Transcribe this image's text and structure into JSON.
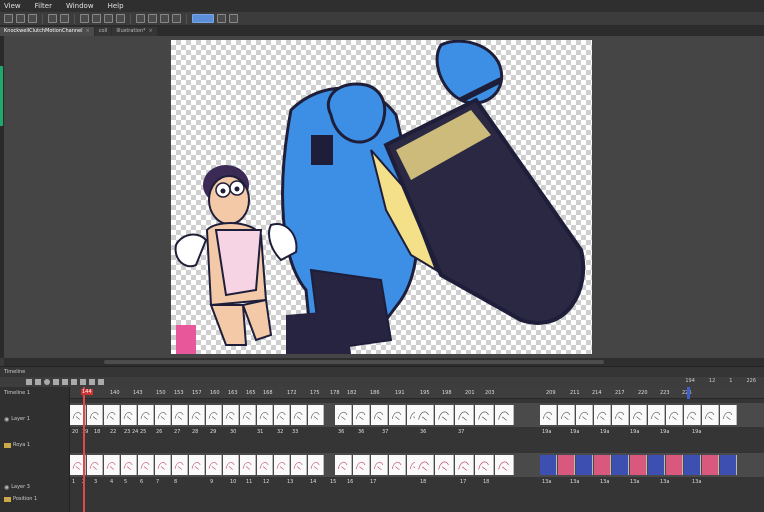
{
  "menu": [
    "View",
    "Filter",
    "Window",
    "Help"
  ],
  "tabs": [
    {
      "label": "KnockwellClutchMotionChannel",
      "active": true
    },
    {
      "label": "coll",
      "active": false
    },
    {
      "label": "Illustration*",
      "active": false
    }
  ],
  "timeline": {
    "title": "Timeline",
    "track_selector": "Timeline 1",
    "right_labels": [
      "194",
      "12",
      "1",
      "226"
    ],
    "playhead_frame": "144",
    "ruler": [
      {
        "label": "140",
        "pos": 40
      },
      {
        "label": "143",
        "pos": 63
      },
      {
        "label": "150",
        "pos": 86
      },
      {
        "label": "153",
        "pos": 104
      },
      {
        "label": "157",
        "pos": 122
      },
      {
        "label": "160",
        "pos": 140
      },
      {
        "label": "163",
        "pos": 158
      },
      {
        "label": "165",
        "pos": 176
      },
      {
        "label": "168",
        "pos": 193
      },
      {
        "label": "172",
        "pos": 217
      },
      {
        "label": "175",
        "pos": 240
      },
      {
        "label": "178",
        "pos": 260
      },
      {
        "label": "182",
        "pos": 277
      },
      {
        "label": "186",
        "pos": 300
      },
      {
        "label": "191",
        "pos": 325
      },
      {
        "label": "195",
        "pos": 350
      },
      {
        "label": "198",
        "pos": 372
      },
      {
        "label": "201",
        "pos": 395
      },
      {
        "label": "203",
        "pos": 415
      },
      {
        "label": "209",
        "pos": 476
      },
      {
        "label": "211",
        "pos": 500
      },
      {
        "label": "214",
        "pos": 522
      },
      {
        "label": "217",
        "pos": 545
      },
      {
        "label": "220",
        "pos": 568
      },
      {
        "label": "223",
        "pos": 590
      },
      {
        "label": "226",
        "pos": 612
      }
    ],
    "tracks": [
      {
        "name": "Layer 1",
        "icon": "eye"
      },
      {
        "name": "Roya 1",
        "icon": "folder"
      },
      {
        "name": "Layer 3",
        "icon": "eye"
      },
      {
        "name": "Position 1",
        "icon": "folder"
      }
    ],
    "row1_numbers": [
      {
        "label": "20",
        "pos": 2
      },
      {
        "label": "19",
        "pos": 12
      },
      {
        "label": "18",
        "pos": 24
      },
      {
        "label": "22",
        "pos": 40
      },
      {
        "label": "23",
        "pos": 54
      },
      {
        "label": "24",
        "pos": 62
      },
      {
        "label": "25",
        "pos": 70
      },
      {
        "label": "26",
        "pos": 86
      },
      {
        "label": "27",
        "pos": 104
      },
      {
        "label": "28",
        "pos": 122
      },
      {
        "label": "29",
        "pos": 140
      },
      {
        "label": "30",
        "pos": 160
      },
      {
        "label": "31",
        "pos": 187
      },
      {
        "label": "32",
        "pos": 207
      },
      {
        "label": "33",
        "pos": 222
      },
      {
        "label": "36",
        "pos": 268
      },
      {
        "label": "36",
        "pos": 288
      },
      {
        "label": "37",
        "pos": 312
      },
      {
        "label": "36",
        "pos": 350
      },
      {
        "label": "37",
        "pos": 388
      },
      {
        "label": "19a",
        "pos": 472
      },
      {
        "label": "19a",
        "pos": 500
      },
      {
        "label": "19a",
        "pos": 530
      },
      {
        "label": "19a",
        "pos": 560
      },
      {
        "label": "19a",
        "pos": 590
      },
      {
        "label": "19a",
        "pos": 622
      }
    ],
    "row2_numbers": [
      {
        "label": "1",
        "pos": 2
      },
      {
        "label": "2",
        "pos": 12
      },
      {
        "label": "3",
        "pos": 24
      },
      {
        "label": "4",
        "pos": 40
      },
      {
        "label": "5",
        "pos": 54
      },
      {
        "label": "6",
        "pos": 70
      },
      {
        "label": "7",
        "pos": 86
      },
      {
        "label": "8",
        "pos": 104
      },
      {
        "label": "9",
        "pos": 140
      },
      {
        "label": "10",
        "pos": 160
      },
      {
        "label": "11",
        "pos": 176
      },
      {
        "label": "12",
        "pos": 193
      },
      {
        "label": "13",
        "pos": 217
      },
      {
        "label": "14",
        "pos": 240
      },
      {
        "label": "15",
        "pos": 260
      },
      {
        "label": "16",
        "pos": 277
      },
      {
        "label": "17",
        "pos": 300
      },
      {
        "label": "18",
        "pos": 350
      },
      {
        "label": "17",
        "pos": 390
      },
      {
        "label": "18",
        "pos": 413
      },
      {
        "label": "13a",
        "pos": 472
      },
      {
        "label": "13a",
        "pos": 500
      },
      {
        "label": "13a",
        "pos": 530
      },
      {
        "label": "13a",
        "pos": 560
      },
      {
        "label": "13a",
        "pos": 590
      },
      {
        "label": "13a",
        "pos": 622
      }
    ]
  },
  "colors": {
    "accent": "#5b8fd9",
    "playhead": "#e04848",
    "canvas_bg": "#454545"
  }
}
